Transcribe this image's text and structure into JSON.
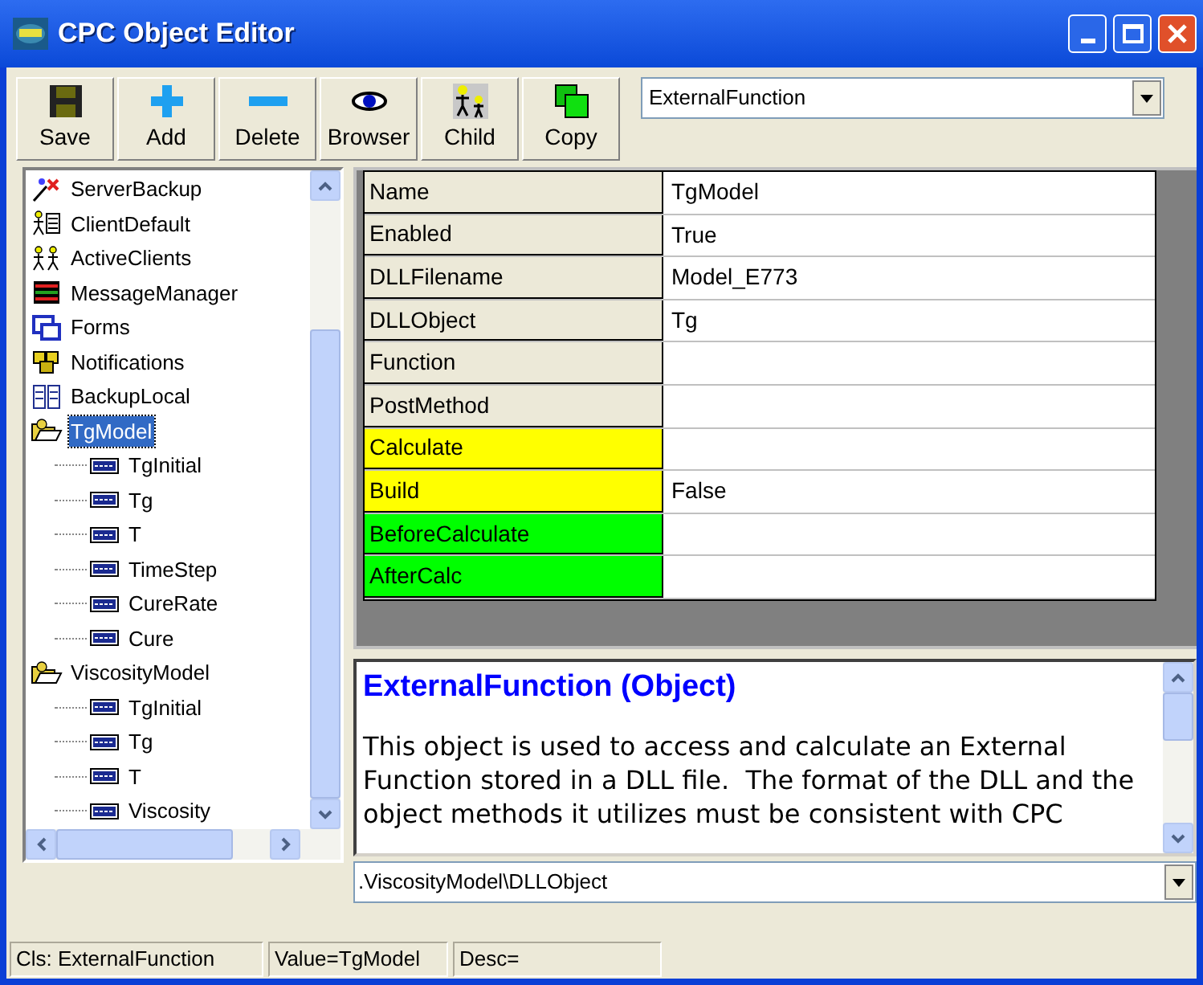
{
  "window": {
    "title": "CPC Object Editor"
  },
  "toolbar": [
    {
      "label": "Save",
      "kind": "save"
    },
    {
      "label": "Add",
      "kind": "add"
    },
    {
      "label": "Delete",
      "kind": "delete"
    },
    {
      "label": "Browser",
      "kind": "eye"
    },
    {
      "label": "Child",
      "kind": "child"
    },
    {
      "label": "Copy",
      "kind": "copy"
    }
  ],
  "class_combo": {
    "value": "ExternalFunction"
  },
  "tree": [
    {
      "label": "ServerBackup",
      "kind": "wizard",
      "selected": false
    },
    {
      "label": "ClientDefault",
      "kind": "person",
      "selected": false
    },
    {
      "label": "ActiveClients",
      "kind": "people",
      "selected": false
    },
    {
      "label": "MessageManager",
      "kind": "grid",
      "selected": false
    },
    {
      "label": "Forms",
      "kind": "forms",
      "selected": false
    },
    {
      "label": "Notifications",
      "kind": "group",
      "selected": false
    },
    {
      "label": "BackupLocal",
      "kind": "backup",
      "selected": false
    },
    {
      "label": "TgModel",
      "kind": "folder",
      "selected": true,
      "children": [
        {
          "label": "TgInitial",
          "kind": "variable",
          "selected": false
        },
        {
          "label": "Tg",
          "kind": "variable",
          "selected": false
        },
        {
          "label": "T",
          "kind": "variable",
          "selected": false
        },
        {
          "label": "TimeStep",
          "kind": "variable",
          "selected": false
        },
        {
          "label": "CureRate",
          "kind": "variable",
          "selected": false
        },
        {
          "label": "Cure",
          "kind": "variable",
          "selected": false
        }
      ]
    },
    {
      "label": "ViscosityModel",
      "kind": "folder",
      "selected": false,
      "children": [
        {
          "label": "TgInitial",
          "kind": "variable",
          "selected": false
        },
        {
          "label": "Tg",
          "kind": "variable",
          "selected": false
        },
        {
          "label": "T",
          "kind": "variable",
          "selected": false
        },
        {
          "label": "Viscosity",
          "kind": "variable",
          "selected": false
        }
      ]
    }
  ],
  "properties": [
    {
      "name": "Name",
      "value": "TgModel",
      "color": "#ece9d8"
    },
    {
      "name": "Enabled",
      "value": "True",
      "color": "#ece9d8"
    },
    {
      "name": "DLLFilename",
      "value": "Model_E773",
      "color": "#ece9d8"
    },
    {
      "name": "DLLObject",
      "value": "Tg",
      "color": "#ece9d8"
    },
    {
      "name": "Function",
      "color": "#ece9d8"
    },
    {
      "name": "PostMethod",
      "color": "#ece9d8"
    },
    {
      "name": "Calculate",
      "color": "#ffff00"
    },
    {
      "name": "Build",
      "value": "False",
      "color": "#ffff00"
    },
    {
      "name": "BeforeCalculate",
      "color": "#00ff00"
    },
    {
      "name": "AfterCalc",
      "color": "#00ff00"
    }
  ],
  "description": {
    "title": "ExternalFunction (Object)",
    "text": "This object is used to access and calculate an External Function stored in a DLL file.  The format of the DLL and the object methods it utilizes must be consistent with CPC"
  },
  "path_combo": {
    "value": ".ViscosityModel\\DLLObject"
  },
  "status_bar": [
    "Cls: ExternalFunction",
    "Value=TgModel",
    "Desc="
  ]
}
